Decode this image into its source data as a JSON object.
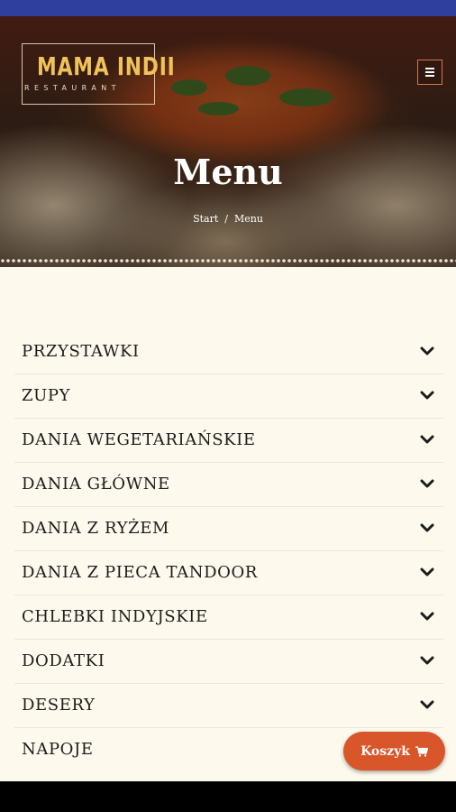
{
  "header": {
    "logo_title": "MAMA INDII",
    "logo_subtitle": "RESTAURANT",
    "menu_icon": "hamburger-menu-icon"
  },
  "hero": {
    "title": "Menu",
    "breadcrumb": {
      "home": "Start",
      "separator": "/",
      "current": "Menu"
    }
  },
  "categories": [
    {
      "label": "PRZYSTAWKI",
      "icon": "chevron-down-icon"
    },
    {
      "label": "ZUPY",
      "icon": "chevron-down-icon"
    },
    {
      "label": "DANIA WEGETARIAŃSKIE",
      "icon": "chevron-down-icon"
    },
    {
      "label": "DANIA GŁÓWNE",
      "icon": "chevron-down-icon"
    },
    {
      "label": "DANIA Z RYŻEM",
      "icon": "chevron-down-icon"
    },
    {
      "label": "DANIA Z PIECA TANDOOR",
      "icon": "chevron-down-icon"
    },
    {
      "label": "CHLEBKI INDYJSKIE",
      "icon": "chevron-down-icon"
    },
    {
      "label": "DODATKI",
      "icon": "chevron-down-icon"
    },
    {
      "label": "DESERY",
      "icon": "chevron-down-icon"
    },
    {
      "label": "NAPOJE",
      "icon": "chevron-down-icon"
    }
  ],
  "cart": {
    "label": "Koszyk",
    "icon": "shopping-cart-icon"
  },
  "colors": {
    "status_bar": "#2f3f9e",
    "background": "#fdf9ec",
    "accent": "#d9552a",
    "logo": "#f0c25a"
  }
}
